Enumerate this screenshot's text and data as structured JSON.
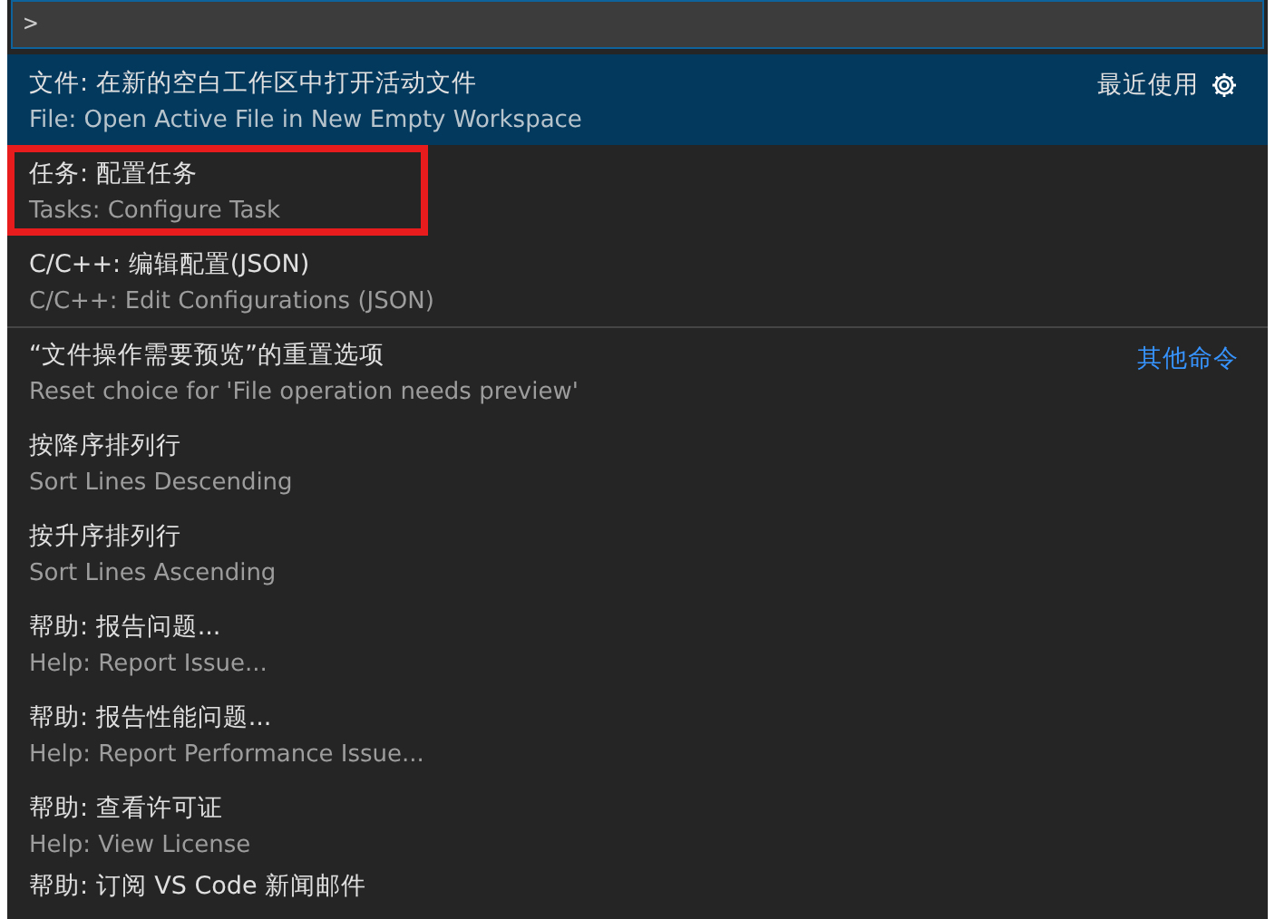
{
  "input": {
    "value": ">"
  },
  "items": [
    {
      "label": "文件: 在新的空白工作区中打开活动文件",
      "detail": "File: Open Active File in New Empty Workspace",
      "selected": true,
      "annotated": false,
      "separator_before": false,
      "group": {
        "label": "最近使用",
        "kind": "recent"
      }
    },
    {
      "label": "任务: 配置任务",
      "detail": "Tasks: Configure Task",
      "selected": false,
      "annotated": true,
      "separator_before": false
    },
    {
      "label": "C/C++: 编辑配置(JSON)",
      "detail": "C/C++: Edit Configurations (JSON)",
      "selected": false,
      "annotated": false,
      "separator_before": false
    },
    {
      "label": "“文件操作需要预览”的重置选项",
      "detail": "Reset choice for 'File operation needs preview'",
      "selected": false,
      "annotated": false,
      "separator_before": true,
      "group": {
        "label": "其他命令",
        "kind": "other"
      }
    },
    {
      "label": "按降序排列行",
      "detail": "Sort Lines Descending",
      "selected": false,
      "annotated": false,
      "separator_before": false
    },
    {
      "label": "按升序排列行",
      "detail": "Sort Lines Ascending",
      "selected": false,
      "annotated": false,
      "separator_before": false
    },
    {
      "label": "帮助: 报告问题...",
      "detail": "Help: Report Issue...",
      "selected": false,
      "annotated": false,
      "separator_before": false
    },
    {
      "label": "帮助: 报告性能问题...",
      "detail": "Help: Report Performance Issue...",
      "selected": false,
      "annotated": false,
      "separator_before": false
    },
    {
      "label": "帮助: 查看许可证",
      "detail": "Help: View License",
      "selected": false,
      "annotated": false,
      "separator_before": false
    },
    {
      "label": "帮助: 订阅 VS Code 新闻邮件",
      "selected": false,
      "annotated": false,
      "separator_before": false
    }
  ]
}
